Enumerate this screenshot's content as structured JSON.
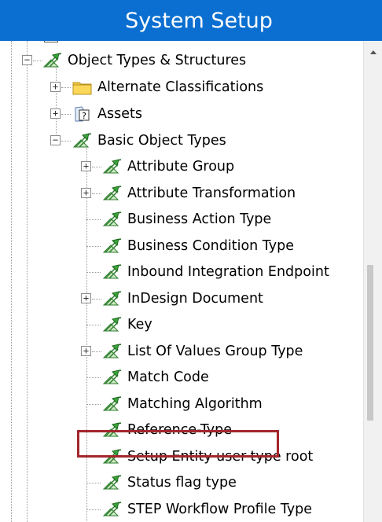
{
  "window": {
    "title": "System Setup"
  },
  "tree": {
    "root": {
      "label": "Object Types & Structures",
      "icon": "object-type-icon",
      "expanded": true
    },
    "level1": [
      {
        "label": "Alternate Classifications",
        "icon": "folder-icon",
        "expander": "+"
      },
      {
        "label": "Assets",
        "icon": "asset-unknown-icon",
        "expander": "+"
      },
      {
        "label": "Basic Object Types",
        "icon": "object-type-icon",
        "expander": "-"
      }
    ],
    "basic_object_types": [
      {
        "label": "Attribute Group",
        "expander": "+"
      },
      {
        "label": "Attribute Transformation",
        "expander": "+"
      },
      {
        "label": "Business Action Type",
        "expander": ""
      },
      {
        "label": "Business Condition Type",
        "expander": ""
      },
      {
        "label": "Inbound Integration Endpoint",
        "expander": ""
      },
      {
        "label": "InDesign Document",
        "expander": "+"
      },
      {
        "label": "Key",
        "expander": ""
      },
      {
        "label": "List Of Values Group Type",
        "expander": "+"
      },
      {
        "label": "Match Code",
        "expander": ""
      },
      {
        "label": "Matching Algorithm",
        "expander": ""
      },
      {
        "label": "Reference-Type",
        "expander": ""
      },
      {
        "label": "Setup Entity user-type root",
        "expander": ""
      },
      {
        "label": "Status flag type",
        "expander": "",
        "highlighted": true
      },
      {
        "label": "STEP Workflow Profile Type",
        "expander": ""
      }
    ]
  },
  "colors": {
    "title_bar": "#0a6fd0",
    "highlight_border": "#a3262c",
    "icon_green": "#3aa33a"
  }
}
